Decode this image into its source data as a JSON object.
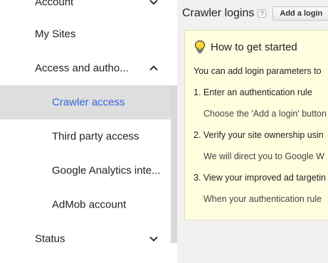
{
  "sidebar": {
    "items": [
      {
        "label": "Account"
      },
      {
        "label": "My Sites"
      },
      {
        "label": "Access and autho..."
      },
      {
        "label": "Crawler access"
      },
      {
        "label": "Third party access"
      },
      {
        "label": "Google Analytics inte..."
      },
      {
        "label": "AdMob account"
      },
      {
        "label": "Status"
      }
    ]
  },
  "header": {
    "title": "Crawler logins",
    "help": "?",
    "add_login_label": "Add a login"
  },
  "panel": {
    "title": "How to get started",
    "intro": "You can add login parameters to",
    "steps": [
      {
        "heading": "1. Enter an authentication rule",
        "detail": "Choose the 'Add a login' button"
      },
      {
        "heading": "2. Verify your site ownership usin",
        "detail": "We will direct you to Google W"
      },
      {
        "heading": "3. View your improved ad targetin",
        "detail": "When your authentication rule"
      }
    ]
  },
  "colors": {
    "active_text": "#3367d6",
    "active_bg": "#dedede",
    "panel_bg": "#ffffe0"
  }
}
